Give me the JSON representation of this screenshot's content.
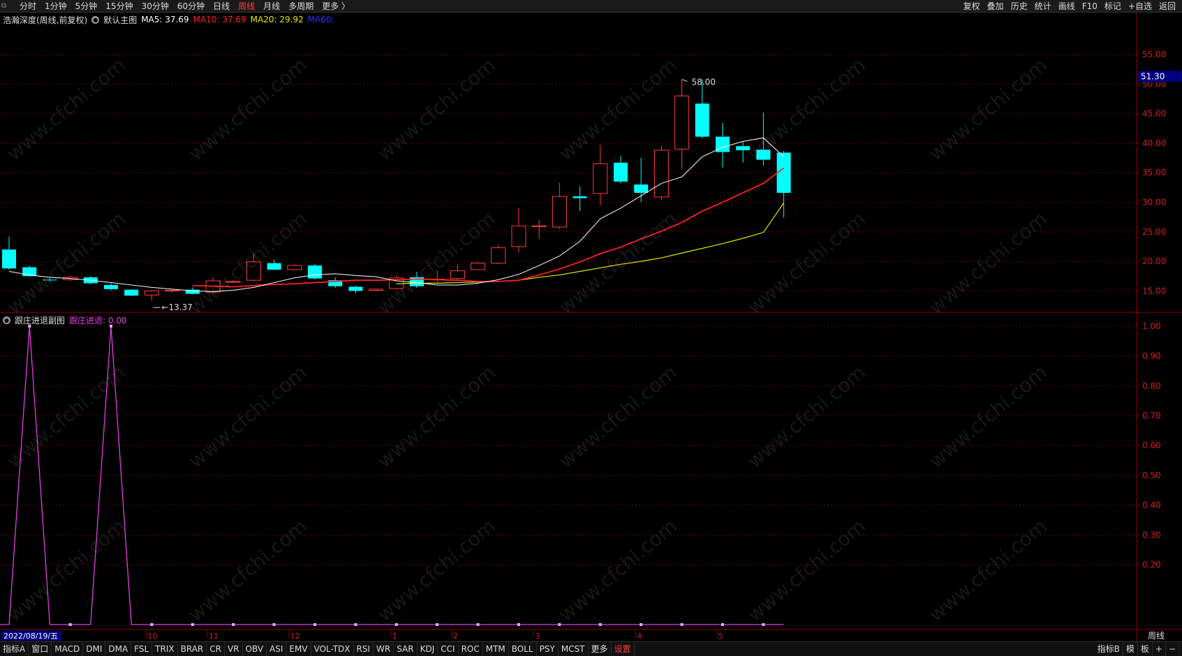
{
  "toolbar": {
    "periods": [
      "分时",
      "1分钟",
      "5分钟",
      "15分钟",
      "30分钟",
      "60分钟",
      "日线",
      "周线",
      "月线",
      "多周期",
      "更多 〉"
    ],
    "active_period": "周线",
    "right_tools": [
      "复权",
      "叠加",
      "历史",
      "统计",
      "画线",
      "F10",
      "标记",
      "+自选",
      "返回"
    ]
  },
  "main_legend": {
    "title": "浩瀚深度(周线,前复权)",
    "chart_name": "默认主图",
    "ma5": "MA5: 37.69",
    "ma10": "MA10: 37.69",
    "ma20": "MA20: 29.92",
    "ma60": "MA60:"
  },
  "sub_legend": {
    "title": "跟庄进退副图",
    "value": "跟庄进退: 0.00"
  },
  "colors": {
    "up": "#ff3c3c",
    "down": "#00ffff",
    "ma5": "#ffffff",
    "ma10": "#ff2020",
    "ma20": "#e6e600",
    "ma60": "#3030ff",
    "indicator": "#e040e0",
    "grid": "#6a0000"
  },
  "chart_data": [
    {
      "type": "candlestick",
      "ylim": [
        11.5,
        59.5
      ],
      "yticks": [
        "15.00",
        "20.00",
        "25.00",
        "30.00",
        "35.00",
        "40.00",
        "45.00",
        "50.00",
        "55.00"
      ],
      "current_price": "51.30",
      "annotations": {
        "high": "58.00",
        "low": "13.37"
      },
      "ohlc": [
        [
          22.0,
          24.2,
          18.6,
          18.8
        ],
        [
          19.0,
          19.3,
          17.4,
          17.5
        ],
        [
          16.9,
          17.2,
          16.6,
          16.8
        ],
        [
          16.9,
          17.5,
          16.7,
          17.3
        ],
        [
          17.3,
          17.5,
          16.1,
          16.3
        ],
        [
          16.0,
          16.3,
          15.1,
          15.3
        ],
        [
          15.2,
          15.3,
          14.1,
          14.2
        ],
        [
          14.3,
          15.2,
          13.37,
          15.0
        ],
        [
          15.0,
          15.2,
          14.7,
          15.1
        ],
        [
          15.2,
          15.6,
          14.4,
          14.5
        ],
        [
          14.8,
          17.3,
          14.5,
          16.7
        ],
        [
          16.6,
          16.8,
          16.4,
          16.6
        ],
        [
          16.8,
          21.3,
          16.6,
          19.9
        ],
        [
          19.7,
          20.3,
          18.5,
          18.6
        ],
        [
          18.6,
          19.6,
          18.5,
          19.3
        ],
        [
          19.3,
          19.6,
          16.9,
          17.1
        ],
        [
          16.8,
          17.3,
          15.5,
          15.8
        ],
        [
          15.7,
          15.9,
          14.6,
          15.0
        ],
        [
          15.1,
          15.4,
          14.9,
          15.3
        ],
        [
          15.4,
          17.7,
          15.2,
          17.2
        ],
        [
          17.3,
          18.2,
          15.5,
          15.8
        ],
        [
          16.9,
          18.5,
          16.4,
          17.0
        ],
        [
          17.1,
          19.5,
          16.7,
          18.4
        ],
        [
          18.6,
          19.9,
          18.5,
          19.7
        ],
        [
          19.7,
          22.8,
          19.5,
          22.3
        ],
        [
          22.5,
          29.0,
          21.5,
          26.0
        ],
        [
          26.0,
          27.0,
          23.8,
          26.0
        ],
        [
          25.8,
          33.3,
          25.5,
          31.0
        ],
        [
          31.0,
          32.7,
          28.5,
          30.7
        ],
        [
          31.5,
          39.7,
          29.5,
          36.5
        ],
        [
          36.7,
          37.8,
          33.2,
          33.5
        ],
        [
          33.0,
          37.5,
          30.0,
          31.6
        ],
        [
          30.9,
          39.5,
          30.3,
          38.8
        ],
        [
          39.0,
          50.8,
          35.7,
          48.0
        ],
        [
          46.7,
          50.8,
          40.8,
          41.1
        ],
        [
          41.1,
          43.4,
          35.9,
          38.5
        ],
        [
          39.5,
          40.3,
          36.7,
          38.8
        ],
        [
          38.9,
          45.2,
          36.2,
          37.2
        ],
        [
          38.4,
          38.7,
          27.4,
          31.6
        ]
      ],
      "ma5": [
        18.3,
        17.7,
        17.3,
        17.1,
        16.8,
        16.4,
        16.0,
        15.6,
        15.3,
        15.0,
        14.9,
        15.1,
        15.6,
        16.4,
        17.2,
        17.7,
        17.9,
        17.6,
        17.4,
        16.7,
        16.4,
        16.0,
        16.0,
        16.3,
        16.9,
        17.8,
        19.3,
        20.9,
        23.4,
        27.2,
        29.0,
        31.1,
        33.2,
        34.3,
        37.7,
        39.3,
        40.3,
        40.9,
        37.7
      ],
      "ma10": [
        null,
        null,
        null,
        null,
        null,
        null,
        null,
        null,
        null,
        15.9,
        15.8,
        15.7,
        15.9,
        16.1,
        16.2,
        16.4,
        16.6,
        16.8,
        16.8,
        16.9,
        17.0,
        16.9,
        16.8,
        16.6,
        16.6,
        16.8,
        17.7,
        18.7,
        19.9,
        21.3,
        22.4,
        23.8,
        25.1,
        26.6,
        28.5,
        30.0,
        31.6,
        33.2,
        35.8
      ],
      "ma20": [
        null,
        null,
        null,
        null,
        null,
        null,
        null,
        null,
        null,
        null,
        null,
        null,
        null,
        null,
        null,
        null,
        null,
        null,
        null,
        16.2,
        16.3,
        16.3,
        16.4,
        16.5,
        16.6,
        16.8,
        17.3,
        17.7,
        18.3,
        18.9,
        19.5,
        20.0,
        20.6,
        21.4,
        22.2,
        23.0,
        23.9,
        24.9,
        29.9
      ],
      "xlabels": [
        {
          "label": "10",
          "i": 7
        },
        {
          "label": "11",
          "i": 10
        },
        {
          "label": "12",
          "i": 14
        },
        {
          "label": "1",
          "i": 19
        },
        {
          "label": "2",
          "i": 22
        },
        {
          "label": "3",
          "i": 26
        },
        {
          "label": "4",
          "i": 31
        },
        {
          "label": "5",
          "i": 35
        }
      ],
      "date_label": "2022/08/19/五",
      "period_label": "周线"
    },
    {
      "type": "line",
      "name": "跟庄进退",
      "ylim": [
        0,
        1.03
      ],
      "yticks": [
        "0.20",
        "0.30",
        "0.40",
        "0.50",
        "0.60",
        "0.70",
        "0.80",
        "0.90",
        "1.00"
      ],
      "values": [
        0,
        1,
        0,
        0,
        0,
        1,
        0,
        0,
        0,
        0,
        0,
        0,
        0,
        0,
        0,
        0,
        0,
        0,
        0,
        0,
        0,
        0,
        0,
        0,
        0,
        0,
        0,
        0,
        0,
        0,
        0,
        0,
        0,
        0,
        0,
        0,
        0,
        0,
        0
      ]
    }
  ],
  "bottom_tabs": [
    "指标A",
    "窗口",
    "MACD",
    "DMI",
    "DMA",
    "FSL",
    "TRIX",
    "BRAR",
    "CR",
    "VR",
    "OBV",
    "ASI",
    "EMV",
    "VOL-TDX",
    "RSI",
    "WR",
    "SAR",
    "KDJ",
    "CCI",
    "ROC",
    "MTM",
    "BOLL",
    "PSY",
    "MCST",
    "更多",
    "设置"
  ],
  "bottom_right": [
    "指标B",
    "模",
    "板",
    "+",
    "−"
  ],
  "watermark": "www.cfchi.com"
}
